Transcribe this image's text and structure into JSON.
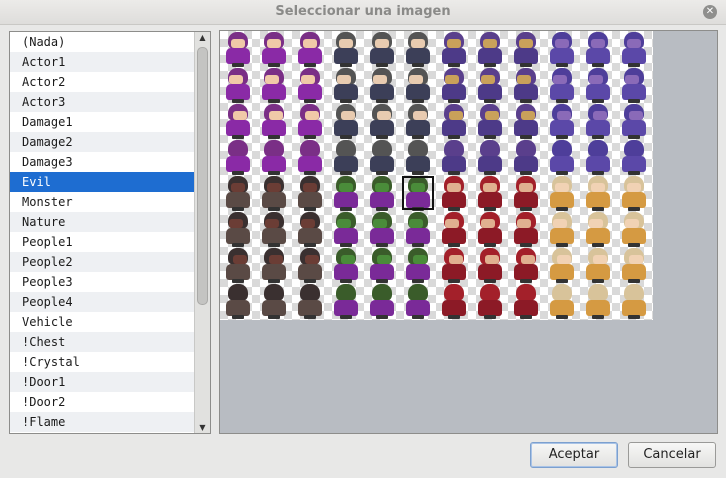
{
  "window": {
    "title": "Seleccionar una imagen"
  },
  "list": {
    "items": [
      "(Nada)",
      "Actor1",
      "Actor2",
      "Actor3",
      "Damage1",
      "Damage2",
      "Damage3",
      "Evil",
      "Monster",
      "Nature",
      "People1",
      "People2",
      "People3",
      "People4",
      "Vehicle",
      "!Chest",
      "!Crystal",
      "!Door1",
      "!Door2",
      "!Flame"
    ],
    "selected": "Evil"
  },
  "preview": {
    "sheet": "Evil",
    "columns": 12,
    "rows": 8,
    "selected_sprite": {
      "row": 5,
      "col": 5
    },
    "groups": [
      {
        "hair": "#7a2f86",
        "face": "#f0c9a8",
        "body": "#8a2aa6"
      },
      {
        "hair": "#545454",
        "face": "#e8cbb0",
        "body": "#3c3f58"
      },
      {
        "hair": "#5a3f8c",
        "face": "#c9a15a",
        "body": "#4d3a88"
      },
      {
        "hair": "#4e3e9a",
        "face": "#8a6ab8",
        "body": "#5b48a8"
      },
      {
        "hair": "#3a3030",
        "face": "#6b3d35",
        "body": "#5a4a45"
      },
      {
        "hair": "#3a5c2a",
        "face": "#4a8c3a",
        "body": "#7a2a98"
      },
      {
        "hair": "#a3202a",
        "face": "#e0b090",
        "body": "#8c1a26"
      },
      {
        "hair": "#d8c39a",
        "face": "#f1d2b4",
        "body": "#d59a42"
      }
    ]
  },
  "buttons": {
    "ok": "Aceptar",
    "cancel": "Cancelar"
  },
  "icons": {
    "close": "close-icon",
    "scroll_up": "scroll-up-icon",
    "scroll_down": "scroll-down-icon"
  }
}
